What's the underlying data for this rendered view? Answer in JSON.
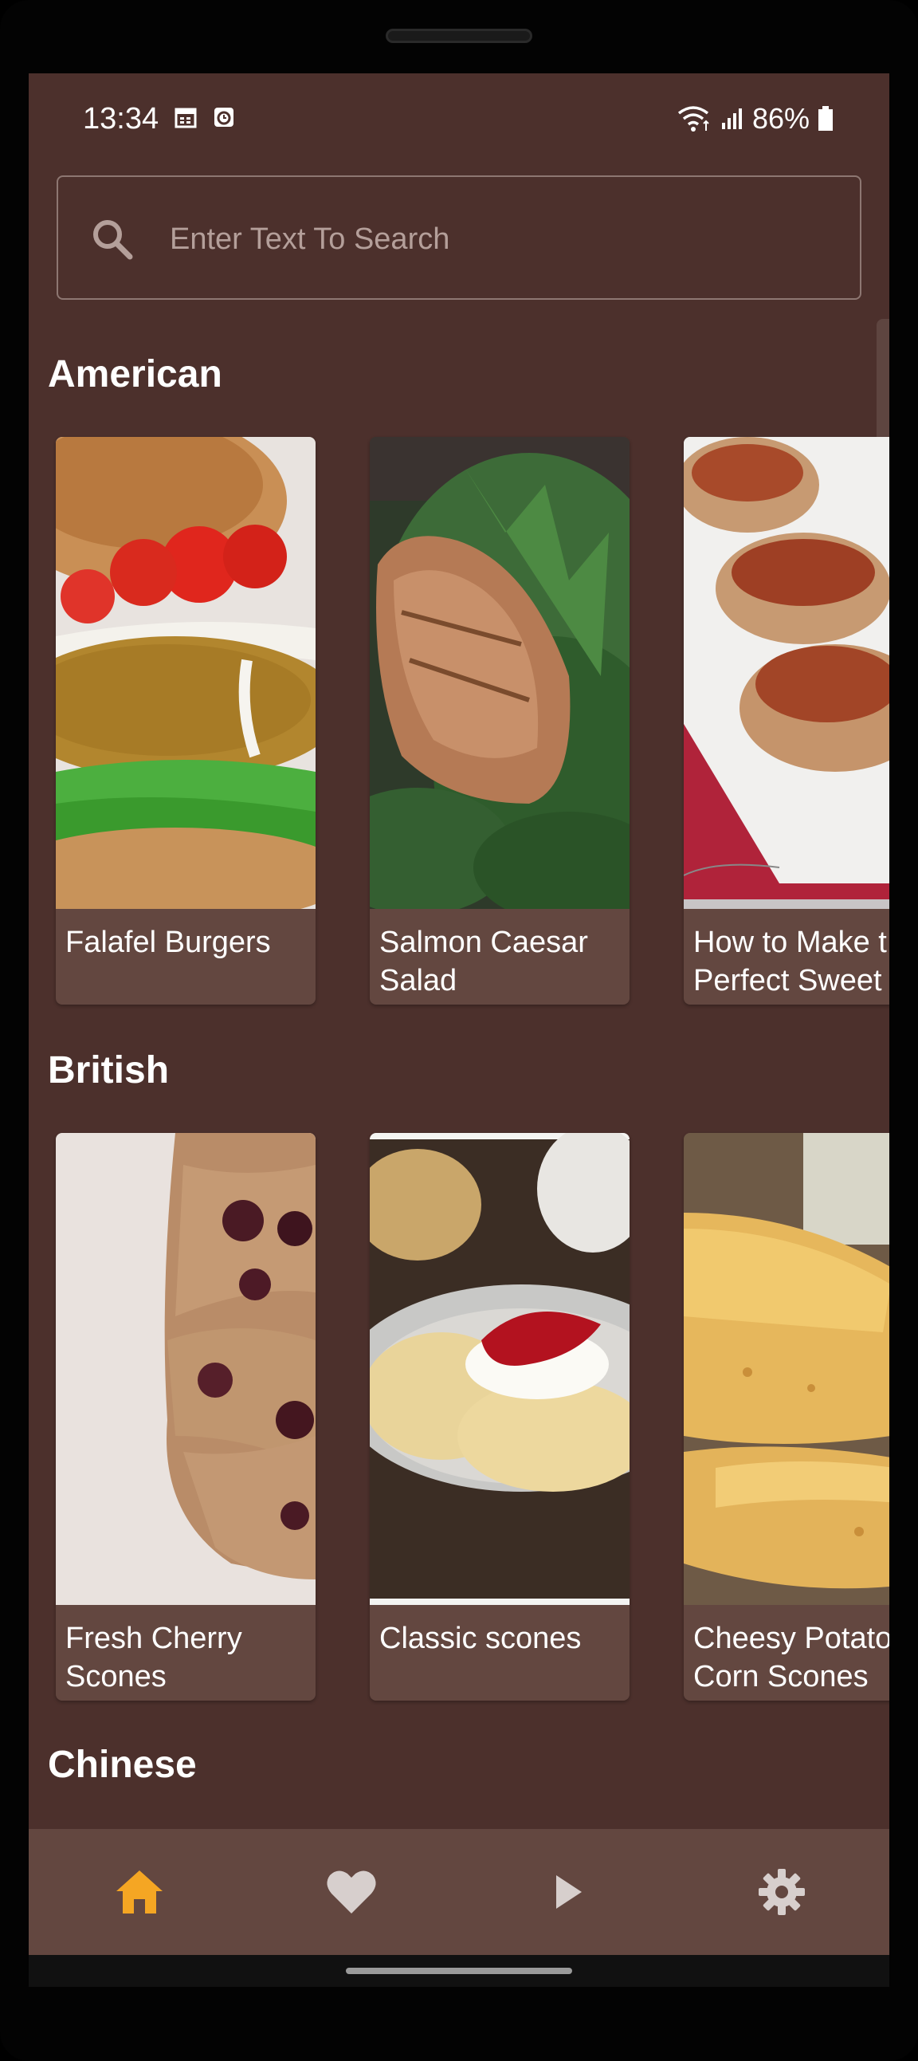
{
  "status_bar": {
    "time": "13:34",
    "battery": "86%"
  },
  "search": {
    "placeholder": "Enter Text To Search"
  },
  "sections": [
    {
      "title": "American",
      "cards": [
        {
          "label": "Falafel Burgers"
        },
        {
          "label": "Salmon Caesar\nSalad"
        },
        {
          "label": "How to Make t\nPerfect Sweet"
        }
      ]
    },
    {
      "title": "British",
      "cards": [
        {
          "label": "Fresh Cherry\nScones"
        },
        {
          "label": "Classic scones"
        },
        {
          "label": "Cheesy Potato\nCorn Scones"
        }
      ]
    },
    {
      "title": "Chinese",
      "cards": []
    }
  ],
  "bottom_nav": {
    "items": [
      {
        "icon": "home-icon",
        "active": true
      },
      {
        "icon": "heart-icon",
        "active": false
      },
      {
        "icon": "play-icon",
        "active": false
      },
      {
        "icon": "gear-icon",
        "active": false
      }
    ],
    "active_color": "#f5a623",
    "inactive_color": "#d7cfcd"
  },
  "colors": {
    "background": "#4c302c",
    "card": "#634740"
  }
}
